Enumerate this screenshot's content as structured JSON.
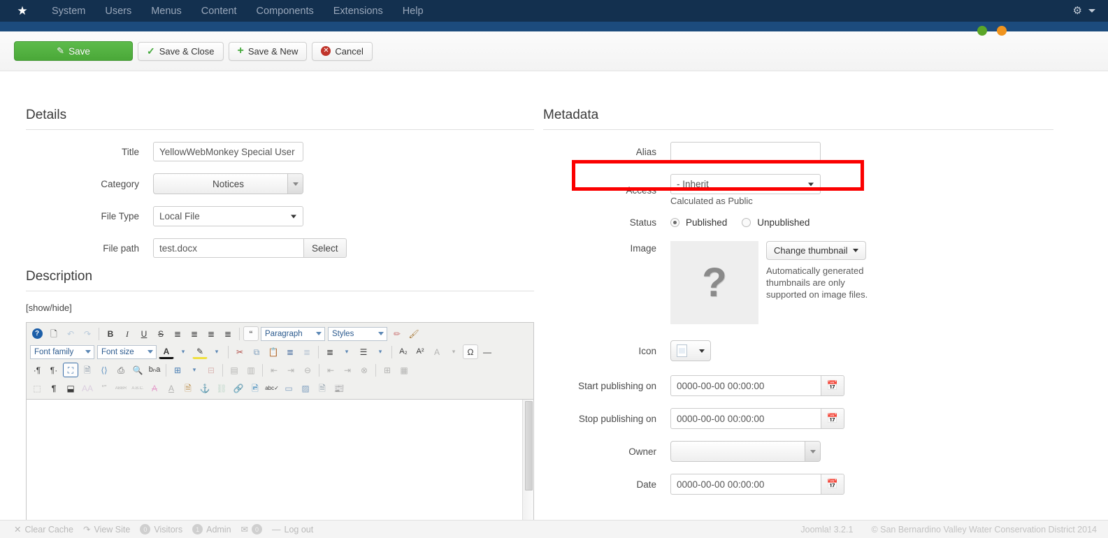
{
  "topbar": {
    "logo_icon": "joomla-logo-icon",
    "menu": [
      {
        "label": "System"
      },
      {
        "label": "Users"
      },
      {
        "label": "Menus"
      },
      {
        "label": "Content"
      },
      {
        "label": "Components"
      },
      {
        "label": "Extensions"
      },
      {
        "label": "Help"
      }
    ],
    "gear_icon": "gear-icon",
    "caret_icon": "chevron-down-icon"
  },
  "toolbar": {
    "save_label": "Save",
    "save_close_label": "Save & Close",
    "save_new_label": "Save & New",
    "cancel_label": "Cancel",
    "save_icon": "pencil-square-icon",
    "save_close_icon": "check-icon",
    "save_new_icon": "plus-icon",
    "cancel_icon": "cancel-circle-icon"
  },
  "details": {
    "heading": "Details",
    "title_label": "Title",
    "title_value": "YellowWebMonkey Special User inf",
    "category_label": "Category",
    "category_value": "Notices",
    "filetype_label": "File Type",
    "filetype_value": "Local File",
    "filepath_label": "File path",
    "filepath_value": "test.docx",
    "select_button": "Select"
  },
  "description": {
    "heading": "Description",
    "showhide": "[show/hide]"
  },
  "editor": {
    "paragraph_label": "Paragraph",
    "styles_label": "Styles",
    "fontfamily_label": "Font family",
    "fontsize_label": "Font size",
    "row1": [
      {
        "icon": "help-icon",
        "glyph": "?",
        "style": "help"
      },
      {
        "icon": "new-document-icon",
        "glyph": "☐"
      },
      {
        "icon": "undo-icon",
        "glyph": "↶",
        "dim": true
      },
      {
        "icon": "redo-icon",
        "glyph": "↷",
        "dim": true
      },
      {
        "sep": true
      },
      {
        "icon": "bold-icon",
        "glyph": "B"
      },
      {
        "icon": "italic-icon",
        "glyph": "I"
      },
      {
        "icon": "underline-icon",
        "glyph": "U"
      },
      {
        "icon": "strikethrough-icon",
        "glyph": "S"
      },
      {
        "icon": "align-left-icon",
        "glyph": "≡"
      },
      {
        "icon": "align-center-icon",
        "glyph": "≡"
      },
      {
        "icon": "align-right-icon",
        "glyph": "≡"
      },
      {
        "icon": "align-justify-icon",
        "glyph": "≡"
      },
      {
        "sep": true
      },
      {
        "icon": "blockquote-icon",
        "glyph": "“",
        "boxed": true
      }
    ],
    "row1_tail": [
      {
        "icon": "eraser-icon",
        "glyph": "✐"
      },
      {
        "icon": "paintbrush-icon",
        "glyph": "✎"
      }
    ],
    "row2": [
      {
        "icon": "text-color-icon",
        "glyph": "A"
      },
      {
        "icon": "text-color-dropdown-icon",
        "glyph": "▾"
      },
      {
        "icon": "highlight-color-icon",
        "glyph": "✐"
      },
      {
        "icon": "highlight-color-dropdown-icon",
        "glyph": "▾"
      },
      {
        "sep": true
      },
      {
        "icon": "cut-icon",
        "glyph": "✂"
      },
      {
        "icon": "copy-icon",
        "glyph": "⧉"
      },
      {
        "icon": "paste-icon",
        "glyph": "Ὄb"
      },
      {
        "icon": "indent-icon",
        "glyph": "⇥"
      },
      {
        "icon": "outdent-icon",
        "glyph": "⇤",
        "dim": true
      },
      {
        "sep": true
      },
      {
        "icon": "numbered-list-icon",
        "glyph": "≣"
      },
      {
        "icon": "numbered-list-dropdown-icon",
        "glyph": "▾"
      },
      {
        "icon": "bullet-list-icon",
        "glyph": "☰"
      },
      {
        "icon": "bullet-list-dropdown-icon",
        "glyph": "▾"
      },
      {
        "sep": true
      },
      {
        "icon": "subscript-icon",
        "glyph": "A₂"
      },
      {
        "icon": "superscript-icon",
        "glyph": "A²"
      },
      {
        "icon": "clear-formatting-icon",
        "glyph": "A",
        "dim": true
      },
      {
        "icon": "clear-formatting-dropdown-icon",
        "glyph": "▾",
        "dim": true
      },
      {
        "icon": "special-character-icon",
        "glyph": "Ω",
        "boxed": true
      },
      {
        "icon": "horizontal-rule-icon",
        "glyph": "—"
      }
    ],
    "row3": [
      {
        "icon": "ltr-direction-icon",
        "glyph": "¶"
      },
      {
        "icon": "rtl-direction-icon",
        "glyph": "¶"
      },
      {
        "icon": "fullscreen-icon",
        "glyph": "⛶",
        "boxed": true
      },
      {
        "icon": "preview-icon",
        "glyph": "὜b"
      },
      {
        "icon": "source-code-icon",
        "glyph": "◇"
      },
      {
        "icon": "print-icon",
        "glyph": "⎙"
      },
      {
        "icon": "find-replace-icon",
        "glyph": "☎"
      },
      {
        "icon": "spellcheck-icon",
        "glyph": "bₐ"
      },
      {
        "sep": true
      },
      {
        "icon": "insert-table-icon",
        "glyph": "⊞"
      },
      {
        "icon": "table-dropdown-icon",
        "glyph": "▾"
      },
      {
        "icon": "delete-table-icon",
        "glyph": "⊟",
        "dim": true
      },
      {
        "sep": true
      },
      {
        "icon": "table-row-properties-icon",
        "glyph": "▤",
        "dim": true
      },
      {
        "icon": "table-cell-properties-icon",
        "glyph": "▥",
        "dim": true
      },
      {
        "sep": true
      },
      {
        "icon": "insert-row-before-icon",
        "glyph": "⤒",
        "dim": true
      },
      {
        "icon": "insert-row-after-icon",
        "glyph": "⤓",
        "dim": true
      },
      {
        "icon": "delete-row-icon",
        "glyph": "⊖",
        "dim": true
      },
      {
        "sep": true
      },
      {
        "icon": "insert-column-before-icon",
        "glyph": "⇤",
        "dim": true
      },
      {
        "icon": "insert-column-after-icon",
        "glyph": "⇥",
        "dim": true
      },
      {
        "icon": "delete-column-icon",
        "glyph": "⊗",
        "dim": true
      },
      {
        "sep": true
      },
      {
        "icon": "split-cells-icon",
        "glyph": "⊞",
        "dim": true
      },
      {
        "icon": "merge-cells-icon",
        "glyph": "▦",
        "dim": true
      }
    ],
    "row4": [
      {
        "icon": "visual-aid-icon",
        "glyph": "⬚",
        "dim": true
      },
      {
        "icon": "show-invisible-characters-icon",
        "glyph": "¶"
      },
      {
        "icon": "insert-page-break-icon",
        "glyph": "⬓"
      },
      {
        "icon": "style-props-icon",
        "glyph": "A",
        "dim": true
      },
      {
        "icon": "citation-icon",
        "glyph": "“”",
        "dim": true
      },
      {
        "icon": "abbreviation-icon",
        "glyph": "ABBR",
        "dim": true
      },
      {
        "icon": "acronym-icon",
        "glyph": "A.B.C.",
        "dim": true
      },
      {
        "icon": "delete-text-icon",
        "glyph": "A",
        "dim": true
      },
      {
        "icon": "insert-text-icon",
        "glyph": "A",
        "dim": true
      },
      {
        "icon": "attributes-icon",
        "glyph": "὜e"
      },
      {
        "icon": "anchor-icon",
        "glyph": "⚓"
      },
      {
        "icon": "unlink-icon",
        "glyph": "⛓",
        "dim": true
      },
      {
        "icon": "link-icon",
        "glyph": "ὑ7"
      },
      {
        "icon": "insert-image-icon",
        "glyph": "Ὓc"
      },
      {
        "icon": "spellchecker-icon",
        "glyph": "abc"
      },
      {
        "icon": "insert-layer-icon",
        "glyph": "▭"
      },
      {
        "icon": "toggle-absolute-icon",
        "glyph": "▨"
      },
      {
        "icon": "insert-template-icon",
        "glyph": "὜e"
      },
      {
        "icon": "insert-media-icon",
        "glyph": "὏0"
      }
    ]
  },
  "metadata": {
    "heading": "Metadata",
    "alias_label": "Alias",
    "alias_value": "",
    "access_label": "Access",
    "access_value": "- Inherit",
    "access_helper": "Calculated as Public",
    "status_label": "Status",
    "status_published": "Published",
    "status_unpublished": "Unpublished",
    "status_selected": "Published",
    "image_label": "Image",
    "thumb_placeholder_glyph": "?",
    "change_thumbnail": "Change thumbnail",
    "thumb_note": "Automatically generated thumbnails are only supported on image files.",
    "icon_label": "Icon",
    "icon_picker_icon": "document-icon",
    "start_publishing_label": "Start publishing on",
    "start_publishing_value": "0000-00-00 00:00:00",
    "stop_publishing_label": "Stop publishing on",
    "stop_publishing_value": "0000-00-00 00:00:00",
    "owner_label": "Owner",
    "owner_value": "",
    "date_label": "Date",
    "date_value": "0000-00-00 00:00:00",
    "calendar_icon": "calendar-icon",
    "highlight_color": "#fb0000"
  },
  "footer": {
    "clear_cache": "Clear Cache",
    "view_site": "View Site",
    "visitors": "Visitors",
    "visitors_count": "0",
    "admin": "Admin",
    "admin_count": "1",
    "messages_count": "0",
    "logout": "Log out",
    "version": "Joomla! 3.2.1",
    "copyright": "© San Bernardino Valley Water Conservation District 2014"
  }
}
